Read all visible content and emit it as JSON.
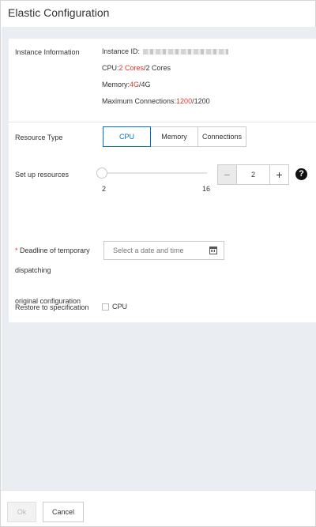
{
  "dialog": {
    "title": "Elastic Configuration"
  },
  "info": {
    "label": "Instance Information",
    "instance_id_label": "Instance ID:",
    "cpu_prefix": "CPU:",
    "cpu_current": "2 Cores",
    "cpu_total": "/2 Cores",
    "memory_prefix": "Memory:",
    "memory_current": "4G",
    "memory_total": "/4G",
    "connections_prefix": "Maximum Connections:",
    "connections_current": "1200",
    "connections_total": "/1200"
  },
  "resource_type": {
    "label": "Resource Type",
    "options": [
      "CPU",
      "Memory",
      "Connections"
    ],
    "selected": "CPU"
  },
  "resources": {
    "label": "Set up resources",
    "slider_min": "2",
    "slider_max": "16",
    "slider_value_fraction": 0,
    "stepper_value": "2",
    "dec_symbol": "−",
    "inc_symbol": "+",
    "help_symbol": "?"
  },
  "deadline": {
    "required_mark": "*",
    "label_line1": "Deadline of temporary",
    "label_line2": "dispatching",
    "placeholder": "Select a date and time"
  },
  "restore": {
    "label_line1": "Restore to specification",
    "label_line2": "original configuration",
    "checkbox_label": "CPU"
  },
  "footer": {
    "ok_label": "Ok",
    "cancel_label": "Cancel"
  },
  "colors": {
    "accent": "#0070cc",
    "highlight": "#e0362c"
  },
  "icons": {
    "calendar": "calendar-icon",
    "help": "help-icon"
  }
}
